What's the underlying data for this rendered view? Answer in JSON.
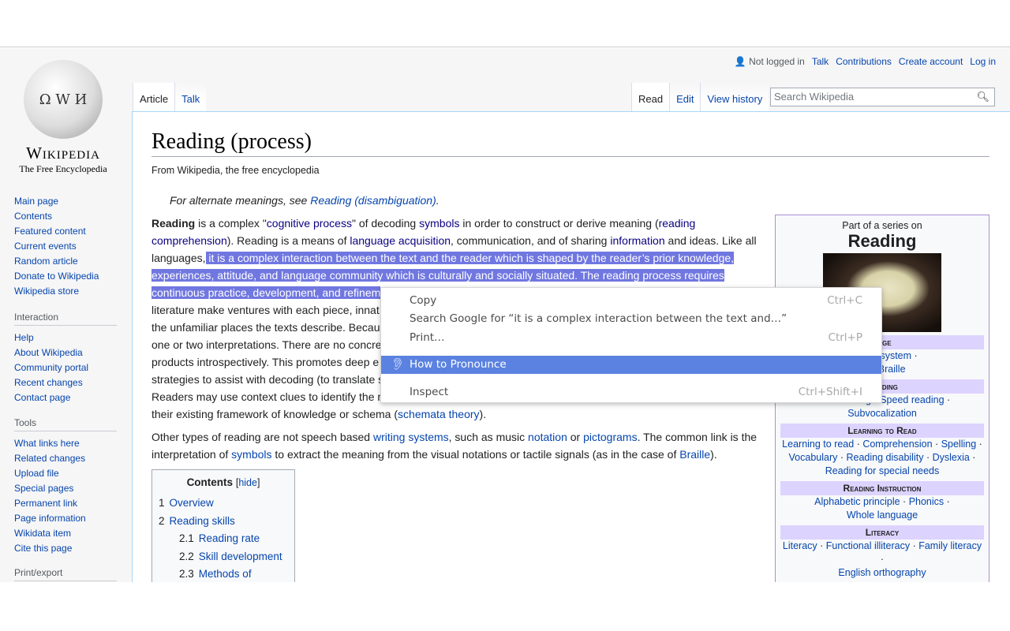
{
  "personal": {
    "not_logged_in": "Not logged in",
    "talk": "Talk",
    "contributions": "Contributions",
    "create_account": "Create account",
    "log_in": "Log in"
  },
  "logo": {
    "wordmark": "Wikipedia",
    "tagline": "The Free Encyclopedia"
  },
  "tabs_left": [
    "Article",
    "Talk"
  ],
  "tabs_right": [
    "Read",
    "Edit",
    "View history"
  ],
  "search": {
    "placeholder": "Search Wikipedia",
    "icon": "search-icon"
  },
  "sidebar": {
    "nav": [
      "Main page",
      "Contents",
      "Featured content",
      "Current events",
      "Random article",
      "Donate to Wikipedia",
      "Wikipedia store"
    ],
    "interaction": {
      "title": "Interaction",
      "items": [
        "Help",
        "About Wikipedia",
        "Community portal",
        "Recent changes",
        "Contact page"
      ]
    },
    "tools": {
      "title": "Tools",
      "items": [
        "What links here",
        "Related changes",
        "Upload file",
        "Special pages",
        "Permanent link",
        "Page information",
        "Wikidata item",
        "Cite this page"
      ]
    },
    "print": {
      "title": "Print/export"
    }
  },
  "article": {
    "title": "Reading (process)",
    "sitesub": "From Wikipedia, the free encyclopedia",
    "hatnote_prefix": "For alternate meanings, see ",
    "hatnote_link": "Reading (disambiguation)",
    "p1": {
      "b": "Reading",
      "t1": " is a complex \"",
      "l1": "cognitive process",
      "t2": "\" of decoding ",
      "l2": "symbols",
      "t3": " in order to construct or derive meaning (",
      "l3": "reading comprehension",
      "t4": "). Reading is a means of ",
      "l4": "language acquisition",
      "t5": ", communication, and of sharing ",
      "l5": "information",
      "t6": " and ideas. Like all languages,",
      "sel": " it is a complex interaction between the text and the reader which is shaped by the reader’s prior knowledge, experiences, attitude, and language community which is culturally and socially situated. The reading process requires continuous practice, development, and refinem",
      "lines": [
        "literature make ventures with each piece, innat",
        "the unfamiliar places the texts describe. Becau",
        "one or two interpretations. There are no concre",
        "products introspectively. This promotes deep e",
        "strategies to assist with decoding (to translate s",
        "Readers may use context clues to identify the m"
      ],
      "t_last": "their existing framework of knowledge or schema (",
      "l_last": "schemata theory",
      "t_end": ")."
    },
    "p2": {
      "t1": "Other types of reading are not speech based ",
      "l1": "writing systems",
      "t2": ", such as music ",
      "l2": "notation",
      "t3": " or ",
      "l3": "pictograms",
      "t4": ". The common link is the interpretation of ",
      "l4": "symbols",
      "t5": " to extract the meaning from the visual notations or tactile signals (as in the case of ",
      "l5": "Braille",
      "t6": ")."
    }
  },
  "toc": {
    "title": "Contents",
    "hide": "hide",
    "items": [
      {
        "n": "1",
        "t": "Overview"
      },
      {
        "n": "2",
        "t": "Reading skills"
      },
      {
        "n": "2.1",
        "t": "Reading rate"
      },
      {
        "n": "2.2",
        "t": "Skill development"
      },
      {
        "n": "2.3",
        "t": "Methods of reading"
      }
    ]
  },
  "infobox": {
    "pre": "Part of a series on",
    "title": "Reading",
    "h1": "uage",
    "r1a": "Writing system",
    "r1b": "hy",
    "r1c": "Braille",
    "h2": "Reading",
    "r2a": "Slow reading",
    "r2b": "Speed reading",
    "r2c": "Subvocalization",
    "h3": "Learning to Read",
    "r3": [
      "Learning to read",
      "Comprehension",
      "Spelling",
      "Vocabulary",
      "Reading disability",
      "Dyslexia",
      "Reading for special needs"
    ],
    "h4": "Reading Instruction",
    "r4": [
      "Alphabetic principle",
      "Phonics",
      "Whole language"
    ],
    "h5": "Literacy",
    "r5": [
      "Literacy",
      "Functional illiteracy",
      "Family literacy",
      "English orthography"
    ]
  },
  "context_menu": {
    "items": [
      {
        "label": "Copy",
        "shortcut": "Ctrl+C"
      },
      {
        "label": "Search Google for “it is a complex interaction between the text and…”"
      },
      {
        "label": "Print…",
        "shortcut": "Ctrl+P"
      },
      {
        "label": "How to Pronounce",
        "icon": "ear-icon",
        "highlighted": true
      },
      {
        "label": "Inspect",
        "shortcut": "Ctrl+Shift+I"
      }
    ]
  },
  "colors": {
    "link": "#0645ad",
    "selection": "#7077e0",
    "menu_highlight": "#5b82e0",
    "infobox_header": "#ddd3ff"
  }
}
